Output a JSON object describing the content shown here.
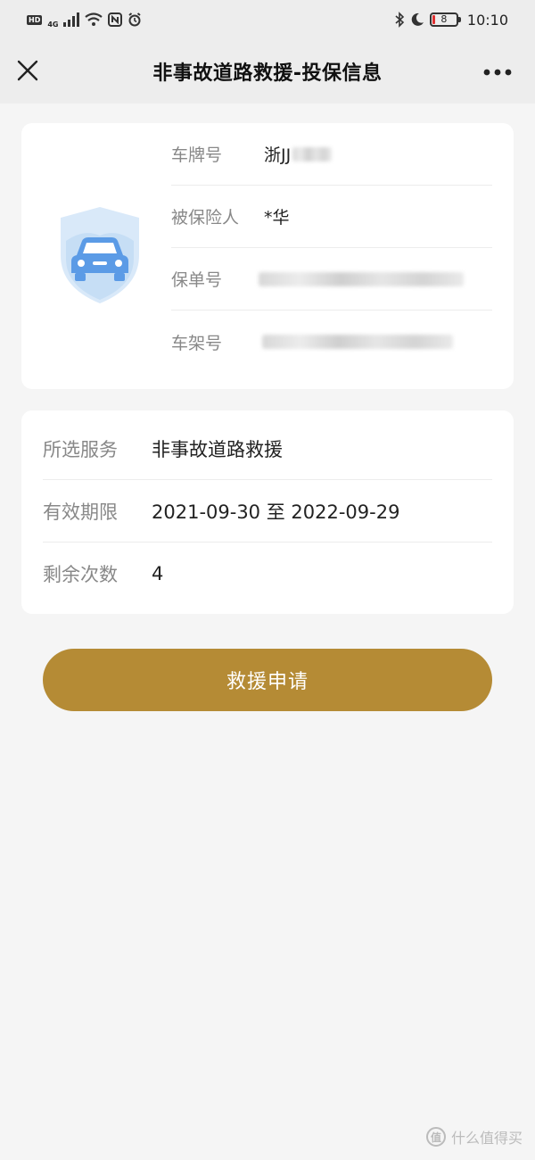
{
  "status_bar": {
    "hd": "HD",
    "network": "4G",
    "battery": "8",
    "time": "10:10"
  },
  "nav": {
    "title": "非事故道路救援-投保信息"
  },
  "insured": {
    "rows": [
      {
        "label": "车牌号",
        "value": "浙JJ"
      },
      {
        "label": "被保险人",
        "value": "*华"
      },
      {
        "label": "保单号",
        "value": ""
      },
      {
        "label": "车架号",
        "value": ""
      }
    ]
  },
  "service": {
    "rows": [
      {
        "label": "所选服务",
        "value": "非事故道路救援"
      },
      {
        "label": "有效期限",
        "value": "2021-09-30 至 2022-09-29"
      },
      {
        "label": "剩余次数",
        "value": "4"
      }
    ]
  },
  "apply_button": {
    "label": "救援申请"
  },
  "watermark": {
    "glyph": "值",
    "text": "什么值得买"
  },
  "colors": {
    "accent": "#b58b35",
    "shield": "#d9e9f9",
    "car": "#5b9be6",
    "battery_low": "#e03030"
  }
}
